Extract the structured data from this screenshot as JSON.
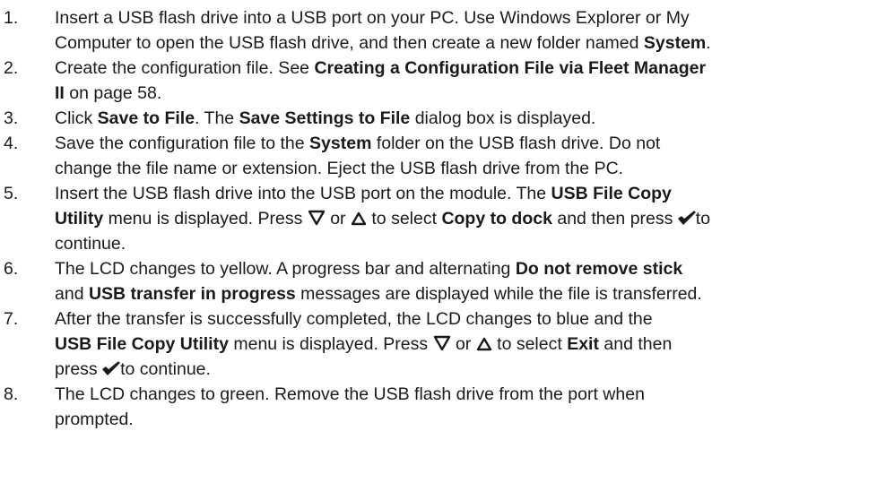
{
  "steps": [
    {
      "num": "1.",
      "lines": [
        [
          {
            "t": "Insert a USB flash drive into a USB port on your PC. Use Windows Explorer or My"
          }
        ],
        [
          {
            "t": "Computer to open the USB flash drive, and then create a new folder named "
          },
          {
            "t": "System",
            "b": true
          },
          {
            "t": "."
          }
        ]
      ]
    },
    {
      "num": "2.",
      "lines": [
        [
          {
            "t": "Create the configuration file. See "
          },
          {
            "t": "Creating a Configuration File via Fleet Manager",
            "b": true
          }
        ],
        [
          {
            "t": "II",
            "b": true
          },
          {
            "t": " on page 58."
          }
        ]
      ]
    },
    {
      "num": "3.",
      "lines": [
        [
          {
            "t": "Click "
          },
          {
            "t": "Save to File",
            "b": true
          },
          {
            "t": ". The "
          },
          {
            "t": "Save Settings to File",
            "b": true
          },
          {
            "t": " dialog box is displayed."
          }
        ]
      ]
    },
    {
      "num": "4.",
      "lines": [
        [
          {
            "t": "Save the configuration file to the "
          },
          {
            "t": "System",
            "b": true
          },
          {
            "t": " folder on the USB flash drive. Do not"
          }
        ],
        [
          {
            "t": "change the file name or extension. Eject the USB flash drive from the PC."
          }
        ]
      ]
    },
    {
      "num": "5.",
      "lines": [
        [
          {
            "t": "Insert the USB flash drive into the USB port on the module. The "
          },
          {
            "t": "USB File Copy",
            "b": true
          }
        ],
        [
          {
            "t": "Utility",
            "b": true
          },
          {
            "t": " menu is displayed. Press "
          },
          {
            "icon": "down-triangle-icon"
          },
          {
            "t": " or "
          },
          {
            "icon": "up-triangle-icon"
          },
          {
            "t": " to select "
          },
          {
            "t": "Copy to dock",
            "b": true
          },
          {
            "t": " and then press "
          },
          {
            "icon": "checkmark-icon"
          },
          {
            "t": "to"
          }
        ],
        [
          {
            "t": "continue."
          }
        ]
      ]
    },
    {
      "num": "6.",
      "lines": [
        [
          {
            "t": "The LCD changes to yellow. A progress bar and alternating "
          },
          {
            "t": "Do not remove stick",
            "b": true
          }
        ],
        [
          {
            "t": "and "
          },
          {
            "t": "USB transfer in progress",
            "b": true
          },
          {
            "t": " messages are displayed while the file is transferred."
          }
        ]
      ]
    },
    {
      "num": "7.",
      "lines": [
        [
          {
            "t": "After the transfer is successfully completed, the LCD changes to blue and the"
          }
        ],
        [
          {
            "t": "USB File Copy Utility",
            "b": true
          },
          {
            "t": " menu is displayed. Press "
          },
          {
            "icon": "down-triangle-icon"
          },
          {
            "t": " or "
          },
          {
            "icon": "up-triangle-icon"
          },
          {
            "t": " to select "
          },
          {
            "t": "Exit",
            "b": true
          },
          {
            "t": " and then"
          }
        ],
        [
          {
            "t": "press "
          },
          {
            "icon": "checkmark-icon"
          },
          {
            "t": "to continue."
          }
        ]
      ]
    },
    {
      "num": "8.",
      "lines": [
        [
          {
            "t": "The LCD changes to green. Remove the USB flash drive from the port when"
          }
        ],
        [
          {
            "t": "prompted."
          }
        ]
      ]
    }
  ]
}
